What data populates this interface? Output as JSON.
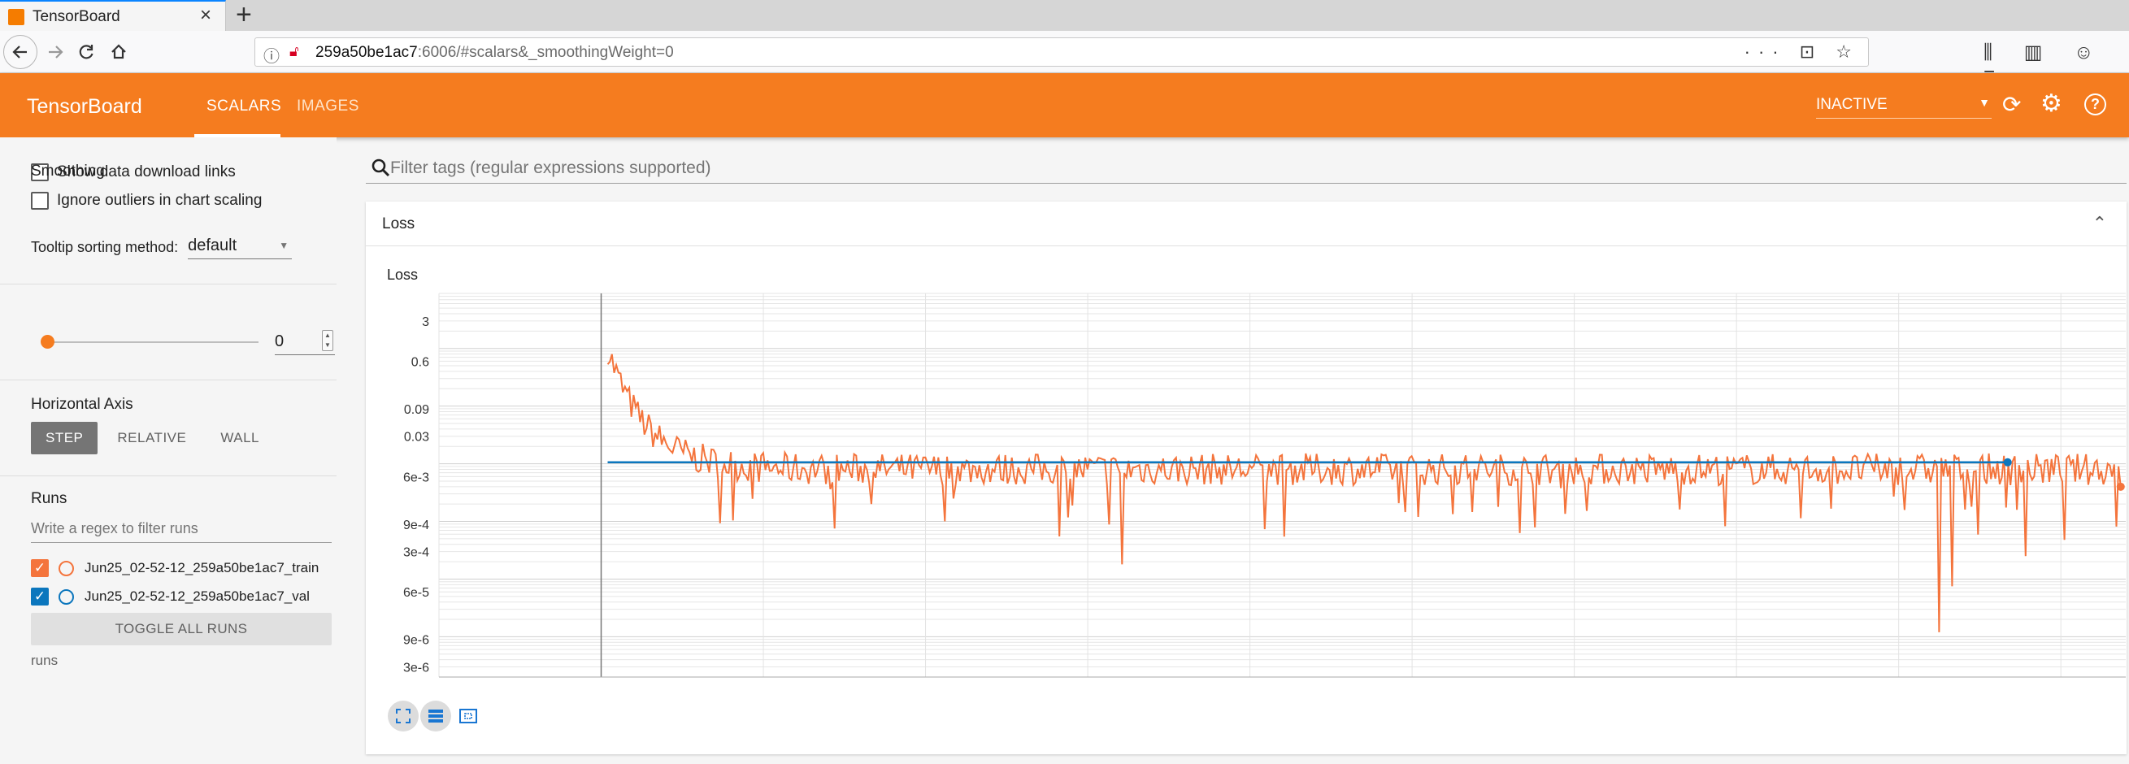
{
  "browser": {
    "tab_title": "TensorBoard",
    "tab_close": "×",
    "new_tab": "+",
    "url_host": "259a50be1ac7",
    "url_rest": ":6006/#scalars&_smoothingWeight=0",
    "url_actions": "··· ⊡ ☆",
    "toolbar_icons": "⫼ ▥ ☺ ≡"
  },
  "header": {
    "logo": "TensorBoard",
    "tabs": [
      {
        "label": "SCALARS",
        "active": true
      },
      {
        "label": "IMAGES",
        "active": false
      }
    ],
    "status_select": "INACTIVE",
    "accent_color": "#f57c1f"
  },
  "sidebar": {
    "show_download_links": "Show data download links",
    "ignore_outliers": "Ignore outliers in chart scaling",
    "tooltip_label": "Tooltip sorting method:",
    "tooltip_value": "default",
    "smoothing_title": "Smoothing",
    "smoothing_value": "0",
    "horizontal_axis_title": "Horizontal Axis",
    "axis_options": [
      "STEP",
      "RELATIVE",
      "WALL"
    ],
    "runs_title": "Runs",
    "runs_filter_placeholder": "Write a regex to filter runs",
    "runs": [
      {
        "name": "Jun25_02-52-12_259a50be1ac7_train",
        "color": "#f4743c",
        "checked": true
      },
      {
        "name": "Jun25_02-52-12_259a50be1ac7_val",
        "color": "#0b76bd",
        "checked": true
      }
    ],
    "toggle_all": "TOGGLE ALL RUNS",
    "runs_caption": "runs"
  },
  "main": {
    "search_placeholder": "Filter tags (regular expressions supported)",
    "card_title": "Loss",
    "card_collapse": "⌃"
  },
  "chart_data": {
    "type": "line",
    "title": "Loss",
    "yscale": "log",
    "ytick_labels": [
      "3",
      "0.6",
      "0.09",
      "0.03",
      "6e-3",
      "9e-4",
      "3e-4",
      "6e-5",
      "9e-6",
      "3e-6"
    ],
    "ylim": [
      2e-06,
      9
    ],
    "grid": true,
    "legend": "none",
    "series": [
      {
        "name": "Jun25_02-52-12_259a50be1ac7_train",
        "color": "#f4743c",
        "x_range": [
          0,
          1
        ],
        "base_value": 0.008,
        "start_value": 1.0,
        "notable_dips": [
          {
            "x": 0.405,
            "y": 0.00018
          },
          {
            "x": 0.58,
            "y": 0.0012
          },
          {
            "x": 0.305,
            "y": 0.0025
          },
          {
            "x": 0.89,
            "y": 1.2e-05
          },
          {
            "x": 0.897,
            "y": 7.5e-05
          },
          {
            "x": 0.94,
            "y": 0.00025
          }
        ],
        "end_value": 0.004
      },
      {
        "name": "Jun25_02-52-12_259a50be1ac7_val",
        "color": "#0b76bd",
        "x_range": [
          0.1,
          0.93
        ],
        "values": [
          0.0106,
          0.0106
        ]
      }
    ]
  }
}
